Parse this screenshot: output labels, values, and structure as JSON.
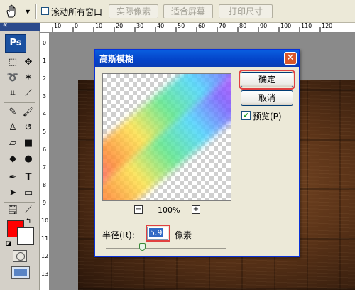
{
  "options_bar": {
    "tool_icon": "hand-icon",
    "checkbox_label": "滚动所有窗口",
    "buttons": [
      "实际像素",
      "适合屏幕",
      "打印尺寸"
    ]
  },
  "toolbox": {
    "logo": "Ps",
    "foreground_color": "#ff0000",
    "background_color": "#ffffff"
  },
  "ruler": {
    "top_ticks": [
      "10",
      "0",
      "10",
      "20",
      "30",
      "40",
      "50",
      "60",
      "70",
      "80",
      "90",
      "100",
      "110",
      "120"
    ],
    "left_ticks": [
      "0",
      "1",
      "2",
      "3",
      "4",
      "5",
      "6",
      "7",
      "8",
      "9",
      "10",
      "11",
      "12",
      "13"
    ]
  },
  "dialog": {
    "title": "高斯模糊",
    "ok_label": "确定",
    "cancel_label": "取消",
    "preview_label": "预览(P)",
    "preview_checked": true,
    "zoom_minus": "−",
    "zoom_plus": "+",
    "zoom_level": "100%",
    "radius_label": "半径(R):",
    "radius_value": "5.9",
    "radius_unit": "像素"
  }
}
